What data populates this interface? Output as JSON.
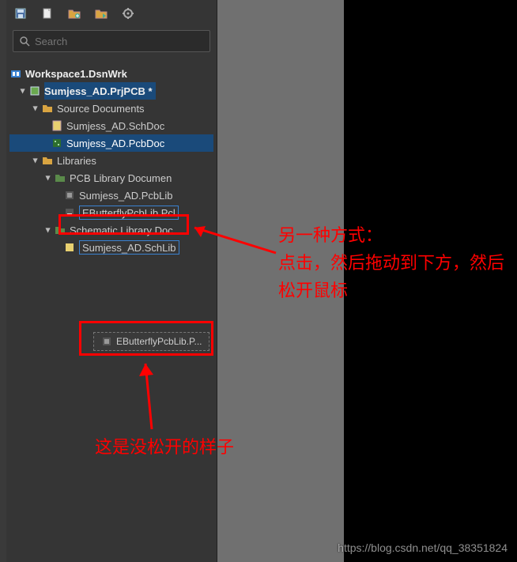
{
  "toolbar": {
    "icons": [
      "save-icon",
      "new-icon",
      "folder-add-icon",
      "folder-arrow-icon",
      "gear-icon"
    ]
  },
  "search": {
    "placeholder": "Search"
  },
  "tree": {
    "root": {
      "label": "Workspace1.DsnWrk"
    },
    "project": {
      "label": "Sumjess_AD.PrjPCB *"
    },
    "sourceDocs": {
      "label": "Source Documents"
    },
    "schDoc": {
      "label": "Sumjess_AD.SchDoc"
    },
    "pcbDoc": {
      "label": "Sumjess_AD.PcbDoc"
    },
    "libraries": {
      "label": "Libraries"
    },
    "pcbLibDocs": {
      "label": "PCB Library Documen"
    },
    "sumjessPcbLib": {
      "label": "Sumjess_AD.PcbLib"
    },
    "ebutterfly": {
      "label": "EButterflyPcbLib.Pcl"
    },
    "schLibDocs": {
      "label": "Schematic Library Doc"
    },
    "sumjessSchLib": {
      "label": "Sumjess_AD.SchLib"
    }
  },
  "dragGhost": {
    "label": "EButterflyPcbLib.P..."
  },
  "annotations": {
    "right": "另一种方式：\n点击，然后拖动到下方，然后松开鼠标",
    "bottom": "这是没松开的样子"
  },
  "watermark": "https://blog.csdn.net/qq_38351824"
}
